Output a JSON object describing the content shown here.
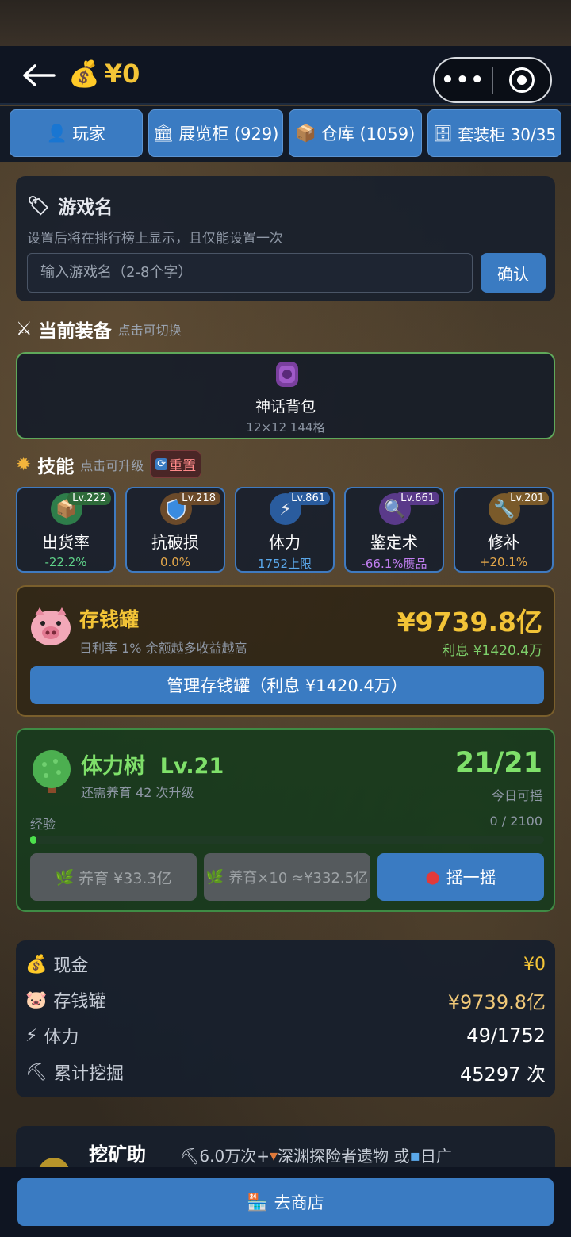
{
  "header": {
    "money_icon": "money-bag-icon",
    "money": "¥0"
  },
  "tabs": [
    {
      "icon": "👤",
      "label": "玩家"
    },
    {
      "icon": "🏛",
      "label": "展览柜 (929)"
    },
    {
      "icon": "📦",
      "label": "仓库 (1059)"
    },
    {
      "icon": "🗄",
      "label": "套装柜 30/35"
    }
  ],
  "game_name": {
    "title": "游戏名",
    "desc": "设置后将在排行榜上显示，且仅能设置一次",
    "placeholder": "输入游戏名（2-8个字）",
    "confirm": "确认"
  },
  "equipment": {
    "title": "当前装备",
    "hint": "点击可切换",
    "item_name": "神话背包",
    "item_desc": "12×12 144格"
  },
  "skills": {
    "title": "技能",
    "hint": "点击可升级",
    "reset": "重置",
    "items": [
      {
        "name": "出货率",
        "level": "Lv.222",
        "value": "-22.2%",
        "value_color": "#5fd38a",
        "icon": "box-icon"
      },
      {
        "name": "抗破损",
        "level": "Lv.218",
        "value": "0.0%",
        "value_color": "#e5a84a",
        "icon": "shield-icon"
      },
      {
        "name": "体力",
        "level": "Lv.861",
        "value": "1752上限",
        "value_color": "#5aa8ea",
        "icon": "lightning-icon"
      },
      {
        "name": "鉴定术",
        "level": "Lv.661",
        "value": "-66.1%赝品",
        "value_color": "#c07ef0",
        "icon": "magnifier-icon"
      },
      {
        "name": "修补",
        "level": "Lv.201",
        "value": "+20.1%",
        "value_color": "#e5a84a",
        "icon": "wrench-icon"
      }
    ]
  },
  "piggy_bank": {
    "title": "存钱罐",
    "desc": "日利率 1%  余额越多收益越高",
    "amount": "¥9739.8亿",
    "interest": "利息 ¥1420.4万",
    "manage_button": "管理存钱罐（利息 ¥1420.4万）"
  },
  "stamina_tree": {
    "title": "体力树  Lv.21",
    "desc": "还需养育 42 次升级",
    "count": "21/21",
    "count_label": "今日可摇",
    "exp_label": "经验",
    "exp_value": "0 / 2100",
    "exp_progress": 0.0,
    "nurture": "养育 ¥33.3亿",
    "nurture10": "养育×10 ≈¥332.5亿",
    "shake": "摇一摇"
  },
  "stats": [
    {
      "icon": "💰",
      "label": "现金",
      "value": "¥0",
      "color": "#f3c437"
    },
    {
      "icon": "🐷",
      "label": "存钱罐",
      "value": "¥9739.8亿",
      "color": "#f0c878"
    },
    {
      "icon": "⚡",
      "label": "体力",
      "value": "49/1752",
      "color": "#ffffff"
    },
    {
      "icon": "⛏",
      "label": "累计挖掘",
      "value": "45297 次",
      "color": "#ffffff"
    }
  ],
  "mining": {
    "title": "挖矿助",
    "desc_a": "⛏6.0万次+",
    "desc_b": "深渊探险者遗物 或 ",
    "desc_c": "日广"
  },
  "bottom": {
    "shop": "去商店"
  }
}
